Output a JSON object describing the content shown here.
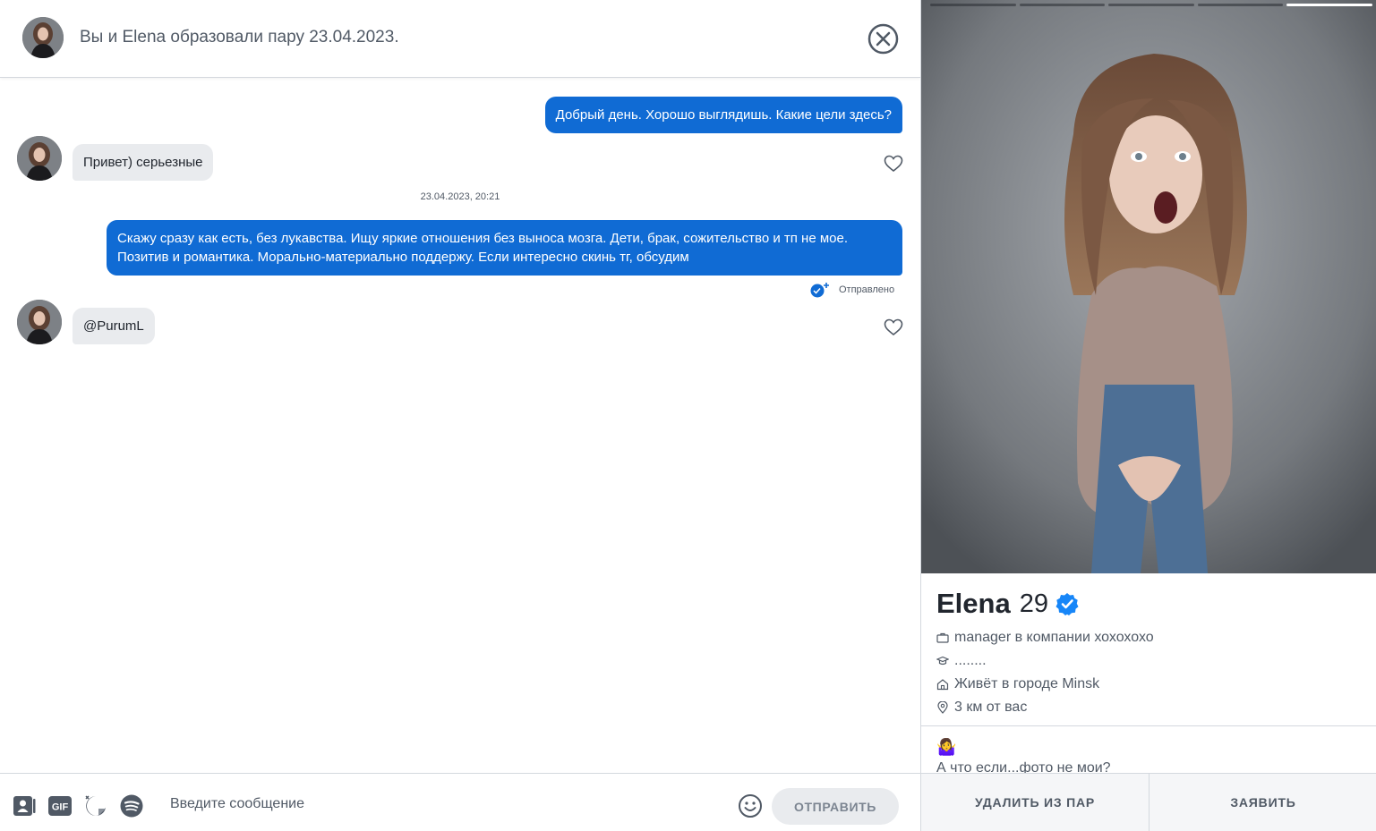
{
  "header": {
    "title": "Вы и Elena образовали пару 23.04.2023.",
    "avatar_icon": "user-avatar"
  },
  "messages": [
    {
      "direction": "outgoing",
      "text": "Добрый день. Хорошо выглядишь. Какие цели здесь?"
    },
    {
      "direction": "incoming",
      "text": "Привет)  серьезные"
    },
    {
      "direction": "timestamp",
      "text": "23.04.2023, 20:21"
    },
    {
      "direction": "outgoing",
      "text": "Скажу сразу как есть, без лукавства. Ищу яркие отношения без выноса мозга. Дети, брак, сожительство и тп не мое. Позитив и романтика. Морально-материально поддержу. Если интересно скинь тг, обсудим",
      "status": "Отправлено"
    },
    {
      "direction": "incoming",
      "text": "@PurumL"
    }
  ],
  "composer": {
    "placeholder": "Введите сообщение",
    "send_label": "ОТПРАВИТЬ",
    "tools": [
      "contact-card-icon",
      "gif-icon",
      "sticker-icon",
      "spotify-icon"
    ]
  },
  "profile": {
    "name": "Elena",
    "age": "29",
    "verified": true,
    "photo_count": 5,
    "active_photo": 5,
    "info": {
      "job": "manager в компании хохохохо",
      "school": "........",
      "city": "Живёт в городе Minsk",
      "distance": "3 км от вас"
    },
    "bio_emoji": "🤷‍♀️",
    "bio_text": "А что если...фото не мои?",
    "unmatch_label": "УДАЛИТЬ ИЗ ПАР",
    "report_label": "ЗАЯВИТЬ"
  },
  "colors": {
    "outgoing_bubble": "#106bd4",
    "incoming_bubble": "#e9ebee",
    "verified_badge": "#1786f8",
    "text_secondary": "#505965"
  }
}
